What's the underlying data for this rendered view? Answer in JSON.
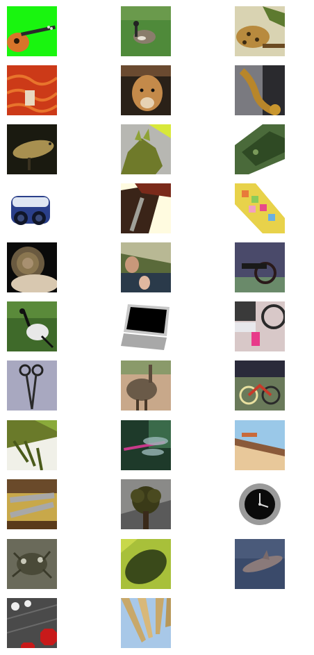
{
  "grid": {
    "columns": 3,
    "thumbnails": [
      {
        "subject": "mandolin-on-green"
      },
      {
        "subject": "goose-on-grass"
      },
      {
        "subject": "leopard-in-tree"
      },
      {
        "subject": "brain-with-label"
      },
      {
        "subject": "cougar-face"
      },
      {
        "subject": "saxophone-played"
      },
      {
        "subject": "fish-in-dark-water"
      },
      {
        "subject": "stegosaurus-model"
      },
      {
        "subject": "tilted-forest-scene"
      },
      {
        "subject": "binoculars"
      },
      {
        "subject": "tilted-interior-beams"
      },
      {
        "subject": "colorful-mosaic-tilted"
      },
      {
        "subject": "nautilus-shell"
      },
      {
        "subject": "person-with-hand-up"
      },
      {
        "subject": "cannon-on-wheels"
      },
      {
        "subject": "ibis-on-grass"
      },
      {
        "subject": "laptop-tilted"
      },
      {
        "subject": "wheelchair"
      },
      {
        "subject": "scissors-forceps"
      },
      {
        "subject": "emu-in-pen"
      },
      {
        "subject": "child-bicycle-and-wheelchair"
      },
      {
        "subject": "rotated-marsh-landscape"
      },
      {
        "subject": "dragonfly"
      },
      {
        "subject": "tilted-beach-scene"
      },
      {
        "subject": "wrench-tool-on-yellow"
      },
      {
        "subject": "bonsai-tree"
      },
      {
        "subject": "wristwatch"
      },
      {
        "subject": "crab-on-rocks"
      },
      {
        "subject": "green-leaf-closeup"
      },
      {
        "subject": "dolphin-underwater"
      },
      {
        "subject": "stop-sign-and-dots"
      },
      {
        "subject": "tilted-fan-blades-sky"
      }
    ]
  }
}
